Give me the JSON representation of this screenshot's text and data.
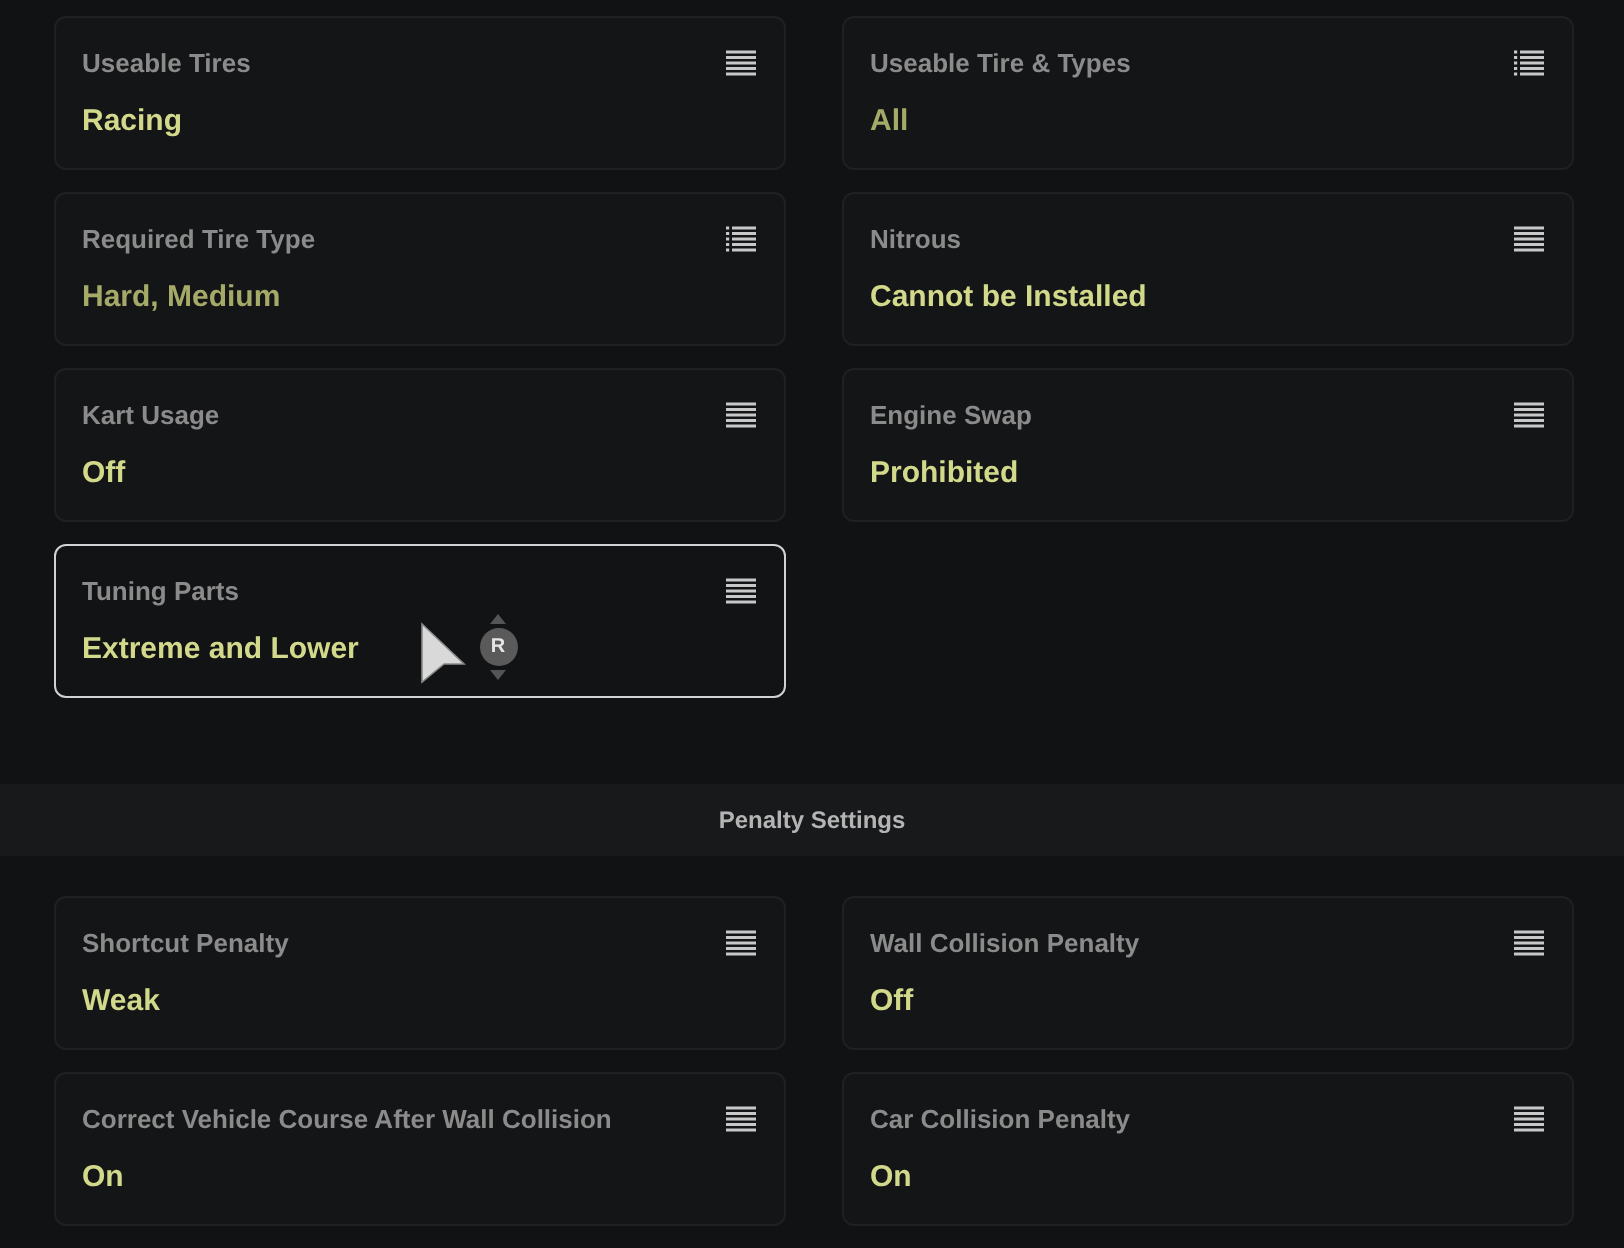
{
  "cards": [
    {
      "kind": "single",
      "label": "Useable Tires",
      "value": "Racing",
      "selected": false
    },
    {
      "kind": "multi",
      "label": "Useable Tire & Types",
      "value": "All",
      "selected": false
    },
    {
      "kind": "multi",
      "label": "Required Tire Type",
      "value": "Hard, Medium",
      "selected": false
    },
    {
      "kind": "single",
      "label": "Nitrous",
      "value": "Cannot be Installed",
      "selected": false
    },
    {
      "kind": "single",
      "label": "Kart Usage",
      "value": "Off",
      "selected": false
    },
    {
      "kind": "single",
      "label": "Engine Swap",
      "value": "Prohibited",
      "selected": false
    },
    {
      "kind": "single",
      "label": "Tuning Parts",
      "value": "Extreme and Lower",
      "selected": true
    }
  ],
  "penalty_section": {
    "title": "Penalty Settings",
    "cards": [
      {
        "kind": "single",
        "label": "Shortcut Penalty",
        "value": "Weak",
        "selected": false
      },
      {
        "kind": "single",
        "label": "Wall Collision Penalty",
        "value": "Off",
        "selected": false
      },
      {
        "kind": "single",
        "label": "Correct Vehicle Course After Wall Collision",
        "value": "On",
        "selected": false
      },
      {
        "kind": "single",
        "label": "Car Collision Penalty",
        "value": "On",
        "selected": false
      }
    ]
  },
  "cursor": {
    "badge": "R"
  }
}
